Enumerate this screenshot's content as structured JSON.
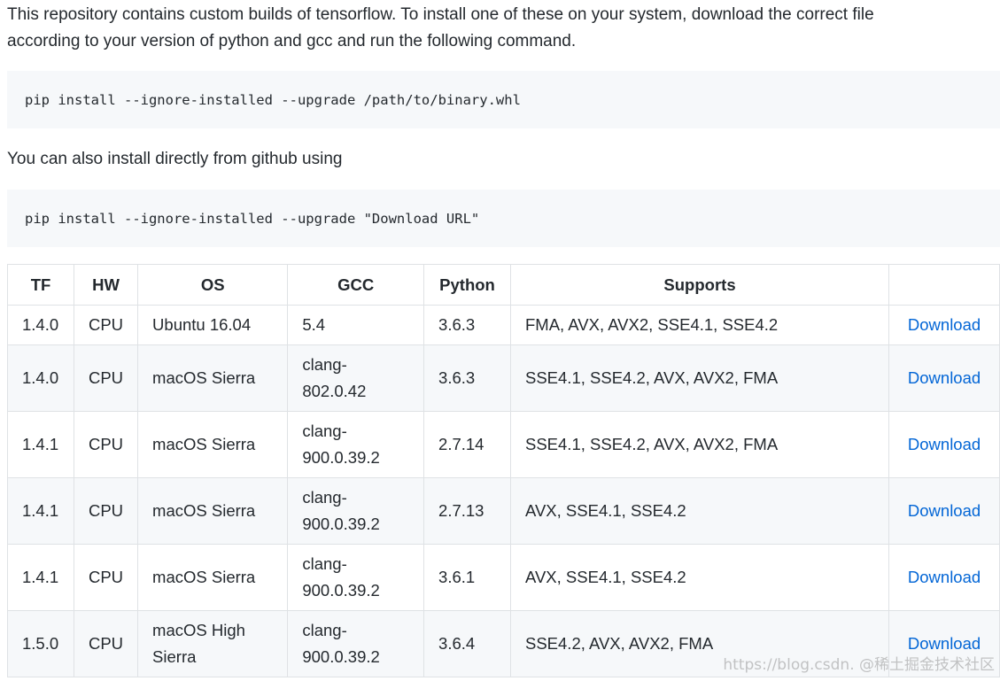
{
  "intro": {
    "line1": "This repository contains custom builds of tensorflow. To install one of these on your system, download the correct file",
    "line2": "according to your version of python and gcc and run the following command."
  },
  "code1": "pip install --ignore-installed --upgrade /path/to/binary.whl",
  "para2": "You can also install directly from github using",
  "code2": "pip install --ignore-installed --upgrade \"Download URL\"",
  "table": {
    "headers": [
      "TF",
      "HW",
      "OS",
      "GCC",
      "Python",
      "Supports",
      ""
    ],
    "rows": [
      {
        "tf": "1.4.0",
        "hw": "CPU",
        "os": [
          "Ubuntu 16.04"
        ],
        "gcc": [
          "5.4"
        ],
        "python": "3.6.3",
        "supports": "FMA, AVX, AVX2, SSE4.1, SSE4.2",
        "link": "Download"
      },
      {
        "tf": "1.4.0",
        "hw": "CPU",
        "os": [
          "macOS Sierra"
        ],
        "gcc": [
          "clang-",
          "802.0.42"
        ],
        "python": "3.6.3",
        "supports": "SSE4.1, SSE4.2, AVX, AVX2, FMA",
        "link": "Download"
      },
      {
        "tf": "1.4.1",
        "hw": "CPU",
        "os": [
          "macOS Sierra"
        ],
        "gcc": [
          "clang-",
          "900.0.39.2"
        ],
        "python": "2.7.14",
        "supports": "SSE4.1, SSE4.2, AVX, AVX2, FMA",
        "link": "Download"
      },
      {
        "tf": "1.4.1",
        "hw": "CPU",
        "os": [
          "macOS Sierra"
        ],
        "gcc": [
          "clang-",
          "900.0.39.2"
        ],
        "python": "2.7.13",
        "supports": "AVX, SSE4.1, SSE4.2",
        "link": "Download"
      },
      {
        "tf": "1.4.1",
        "hw": "CPU",
        "os": [
          "macOS Sierra"
        ],
        "gcc": [
          "clang-",
          "900.0.39.2"
        ],
        "python": "3.6.1",
        "supports": "AVX, SSE4.1, SSE4.2",
        "link": "Download"
      },
      {
        "tf": "1.5.0",
        "hw": "CPU",
        "os": [
          "macOS High",
          "Sierra"
        ],
        "gcc": [
          "clang-",
          "900.0.39.2"
        ],
        "python": "3.6.4",
        "supports": "SSE4.2, AVX, AVX2, FMA",
        "link": "Download"
      }
    ]
  },
  "watermark": "https://blog.csdn. @稀土掘金技术社区"
}
